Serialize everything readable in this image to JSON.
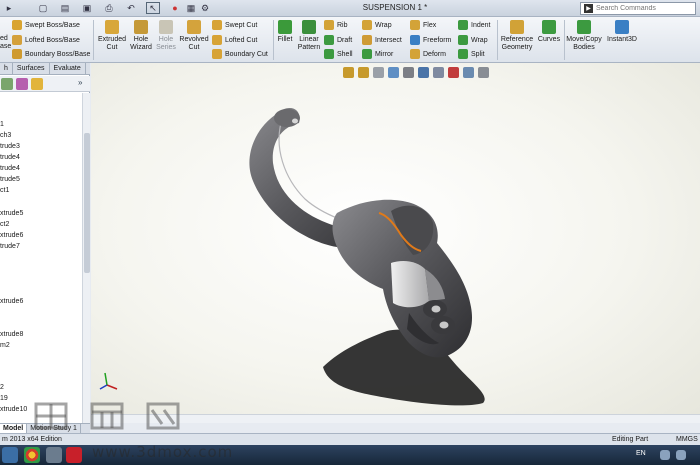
{
  "title_bar": {
    "document_title": "SUSPENSION 1 *",
    "search_placeholder": "Search Commands"
  },
  "ribbon": {
    "left_cut_labels": [
      "ed",
      "ase",
      "Base"
    ],
    "swept_boss": "Swept Boss/Base",
    "lofted_boss": "Lofted Boss/Base",
    "boundary_boss": "Boundary Boss/Base",
    "extruded_cut": [
      "Extruded",
      "Cut"
    ],
    "hole_wizard": [
      "Hole",
      "Wizard"
    ],
    "hole_series": [
      "Hole",
      "Series"
    ],
    "revolved_cut": [
      "Revolved",
      "Cut"
    ],
    "swept_cut": "Swept Cut",
    "lofted_cut": "Lofted Cut",
    "boundary_cut": "Boundary Cut",
    "fillet": "Fillet",
    "linear_pattern": [
      "Linear",
      "Pattern"
    ],
    "rib": "Rib",
    "draft": "Draft",
    "shell": "Shell",
    "wrap": "Wrap",
    "intersect": "Intersect",
    "mirror": "Mirror",
    "flex": "Flex",
    "freeform": "Freeform",
    "deform": "Deform",
    "indent": "Indent",
    "wrap2": "Wrap",
    "split": "Split",
    "reference_geometry": [
      "Reference",
      "Geometry"
    ],
    "curves": "Curves",
    "move_copy_bodies": [
      "Move/Copy",
      "Bodies"
    ],
    "instant3d": "Instant3D"
  },
  "left_panel": {
    "tabs": [
      "h",
      "Surfaces",
      "Evaluate"
    ],
    "tree_items": [
      "1",
      "ch3",
      "trude3",
      "trude4",
      "trude4",
      "trude5",
      "ct1",
      "xtrude5",
      "ct2",
      "xtrude6",
      "trude7",
      "xtrude6",
      "xtrude8",
      "m2",
      "2",
      "19",
      "xtrude10"
    ],
    "bottom_tabs": [
      "Model",
      "Motion Study 1"
    ]
  },
  "status_bar": {
    "left_text": "m 2013 x64 Edition",
    "mode": "Editing Part",
    "units": "MMGS"
  },
  "taskbar": {
    "language": "EN"
  },
  "watermark": {
    "url": "www.3dmox.com"
  },
  "colors": {
    "ribbon_bg": "#e3e8ef",
    "model_body": "#5d5d60",
    "highlight_edge": "#e07a1a",
    "viewport_bg": "#f7f7f1"
  }
}
